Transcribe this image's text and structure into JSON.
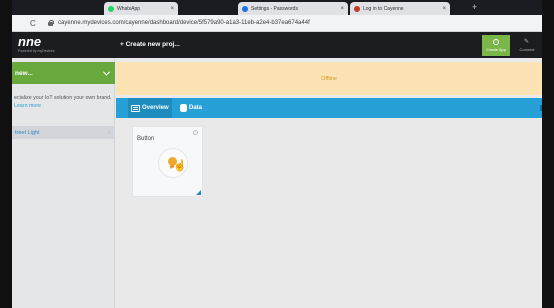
{
  "browser": {
    "tabs": [
      {
        "label": "WhatsApp",
        "icon": "whatsapp-icon",
        "color": "#25d366"
      },
      {
        "label": "Settings - Passwords",
        "icon": "settings-icon",
        "color": "#1a73e8"
      },
      {
        "label": "Log in to Cayenne",
        "icon": "cayenne-icon",
        "color": "#c0392b"
      }
    ],
    "close_glyph": "×",
    "new_tab_glyph": "+",
    "reload_glyph": "C",
    "url": "cayenne.mydevices.com/cayenne/dashboard/device/5f579a90-a1a3-11eb-a2e4-b37ea674a44f"
  },
  "header": {
    "logo": "nne",
    "logo_sub": "Powered by myDevices",
    "create_project": "+ Create new proj...",
    "create_app": "Create App",
    "settings_label": "Connect",
    "settings_glyph": "✎"
  },
  "sidebar": {
    "add_button": "new...",
    "promo_text": "ecialize your IoT solution your own brand.",
    "promo_link": "Learn more",
    "device": "treet Light",
    "device_arrow": "›"
  },
  "status": {
    "text": "Offline",
    "color": "#fce3b3"
  },
  "view_tabs": {
    "overview": "Overview",
    "data": "Data"
  },
  "widget": {
    "title": "Button",
    "icon": "lightbulb-icon",
    "cursor_glyph": "☝"
  },
  "colors": {
    "accent": "#27a0d7",
    "green": "#68a83c",
    "header": "#1b1d20"
  }
}
